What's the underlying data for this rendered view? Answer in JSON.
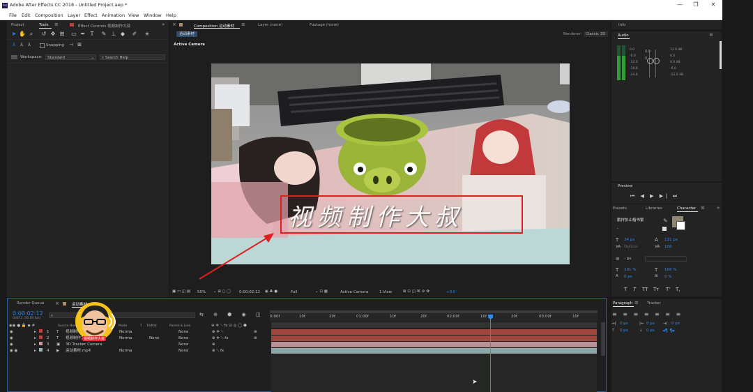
{
  "window": {
    "title": "Adobe After Effects CC 2018 - Untitled Project.aep *",
    "app_icon": "Ae",
    "controls": [
      "—",
      "❐",
      "✕"
    ]
  },
  "menu": [
    "File",
    "Edit",
    "Composition",
    "Layer",
    "Effect",
    "Animation",
    "View",
    "Window",
    "Help"
  ],
  "left_panel": {
    "tabs": [
      "Project",
      "Tools",
      "Effect Controls 视频制作大叔"
    ],
    "snapping_label": "Snapping",
    "workspace_label": "Workspace:",
    "workspace_value": "Standard",
    "search_placeholder": "Search Help"
  },
  "comp_panel": {
    "tab_composition": "Composition 运动素材",
    "tab_layer": "Layer (none)",
    "tab_footage": "Footage (none)",
    "comp_chip": "运动素材",
    "renderer_label": "Renderer:",
    "renderer_value": "Classic 3D",
    "active_camera": "Active Camera",
    "overlay_text": "视频制作大叔",
    "zoom": "50%",
    "timecode": "0;00;02;12",
    "resolution": "Full",
    "camera_view": "Active Camera",
    "view_count": "1 View",
    "exposure": "+0.0"
  },
  "right_panel": {
    "info_tab": "Info",
    "audio_tab": "Audio",
    "audio_left_scale": [
      "0.0",
      "-6.0",
      "-12.0",
      "-18.0",
      "-24.0"
    ],
    "audio_right_scale": [
      "12.0 dB",
      "6.0",
      "0.0 dB",
      "-6.0",
      "-12.0 dB"
    ],
    "audio_fader_values": [
      "0.0",
      "0"
    ],
    "preview_tab": "Preview",
    "tabs_row": [
      "Presets",
      "Libraries",
      "Character"
    ],
    "font_name": "鹏祥执山楷书繁",
    "font_style": "-",
    "font_size": "34 px",
    "leading": "111 px",
    "kerning": "Optical",
    "tracking": "100",
    "stroke_width": "- px",
    "vert_scale": "101 %",
    "horiz_scale": "100 %",
    "baseline": "0 px",
    "tsume": "0 %",
    "typo_buttons": [
      "T",
      "T",
      "TT",
      "Tт",
      "T'",
      "T,"
    ],
    "paragraph_tab": "Paragraph",
    "tracker_tab": "Tracker",
    "indent_values": [
      "0 px",
      "0 px",
      "0 px",
      "0 px",
      "0 px"
    ]
  },
  "timeline": {
    "render_queue_tab": "Render Queue",
    "comp_tab": "运动素材",
    "timecode": "0:00:02:12",
    "frame_info": "00072 (30.00 fps)",
    "col_source": "Source Name",
    "col_mode": "Mode",
    "col_t": "T",
    "col_trkmat": "TrkMat",
    "col_parent": "Parent & Link",
    "layers": [
      {
        "num": "1",
        "type": "T",
        "name": "视频制作大叔",
        "mode": "Norma",
        "trkmat": "",
        "parent": "None",
        "color": "#b8433a"
      },
      {
        "num": "2",
        "type": "T",
        "name": "视频制作大叔",
        "mode": "Norma",
        "trkmat": "None",
        "parent": "None",
        "color": "#b8433a"
      },
      {
        "num": "3",
        "type": "▣",
        "name": "3D Tracker Camera",
        "mode": "",
        "trkmat": "",
        "parent": "None",
        "color": "#c49aa0"
      },
      {
        "num": "4",
        "type": "▶",
        "name": "运动素材.mp4",
        "mode": "Norma",
        "trkmat": "",
        "parent": "None",
        "color": "#9bb3b3"
      }
    ],
    "ruler_labels": [
      "0:00f",
      "10f",
      "20f",
      "01:00f",
      "10f",
      "20f",
      "02:00f",
      "10f",
      "20f",
      "03:00f",
      "10f"
    ],
    "avatar_caption": "视频制作大叔"
  },
  "colors": {
    "accent_blue": "#2d8ceb",
    "annotation_red": "#e02020"
  }
}
